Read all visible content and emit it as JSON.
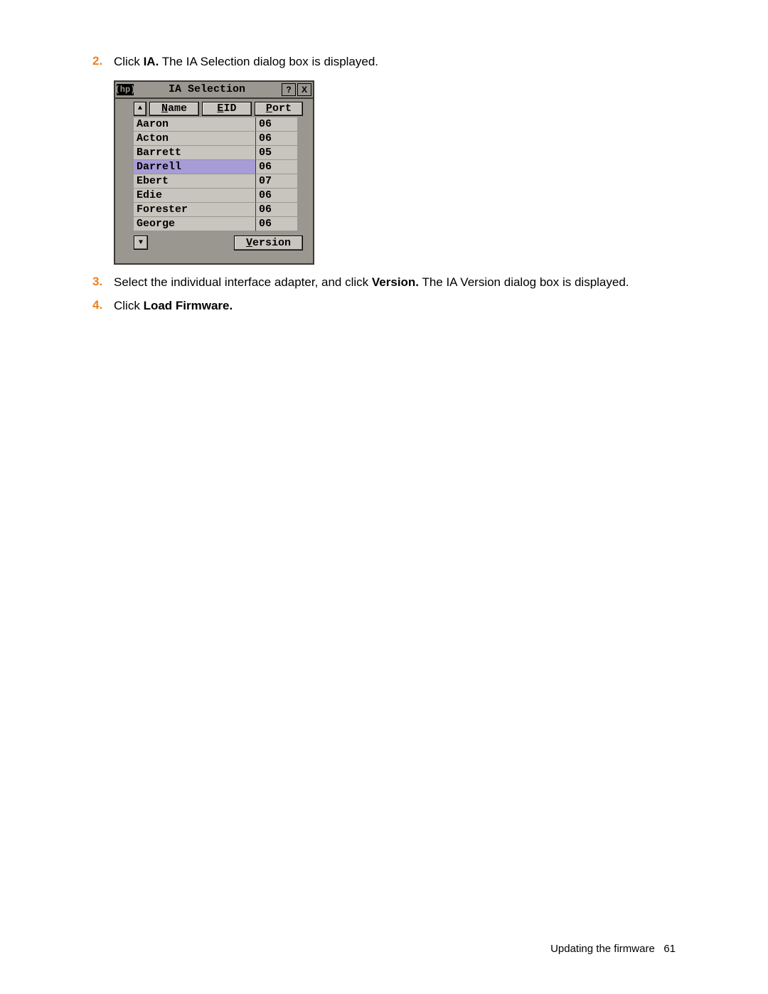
{
  "steps": [
    {
      "num": "2.",
      "prefix": "Click ",
      "bold1": "IA.",
      "rest": " The IA Selection dialog box is displayed."
    },
    {
      "num": "3.",
      "prefix": "Select the individual interface adapter, and click ",
      "bold1": "Version.",
      "rest": " The IA Version dialog box is displayed."
    },
    {
      "num": "4.",
      "prefix": "Click ",
      "bold1": "Load Firmware.",
      "rest": ""
    }
  ],
  "dialog": {
    "title": "IA Selection",
    "help": "?",
    "close": "X",
    "logo": "(hp)",
    "headers": {
      "name": "Name",
      "eid": "EID",
      "port": "Port"
    },
    "scroll_up": "▲",
    "scroll_down": "▼",
    "rows": [
      {
        "name": "Aaron",
        "port": "06",
        "selected": false
      },
      {
        "name": "Acton",
        "port": "06",
        "selected": false
      },
      {
        "name": "Barrett",
        "port": "05",
        "selected": false
      },
      {
        "name": "Darrell",
        "port": "06",
        "selected": true
      },
      {
        "name": "Ebert",
        "port": "07",
        "selected": false
      },
      {
        "name": "Edie",
        "port": "06",
        "selected": false
      },
      {
        "name": "Forester",
        "port": "06",
        "selected": false
      },
      {
        "name": "George",
        "port": "06",
        "selected": false
      }
    ],
    "version_btn": "Version"
  },
  "footer": {
    "section": "Updating the firmware",
    "page": "61"
  }
}
